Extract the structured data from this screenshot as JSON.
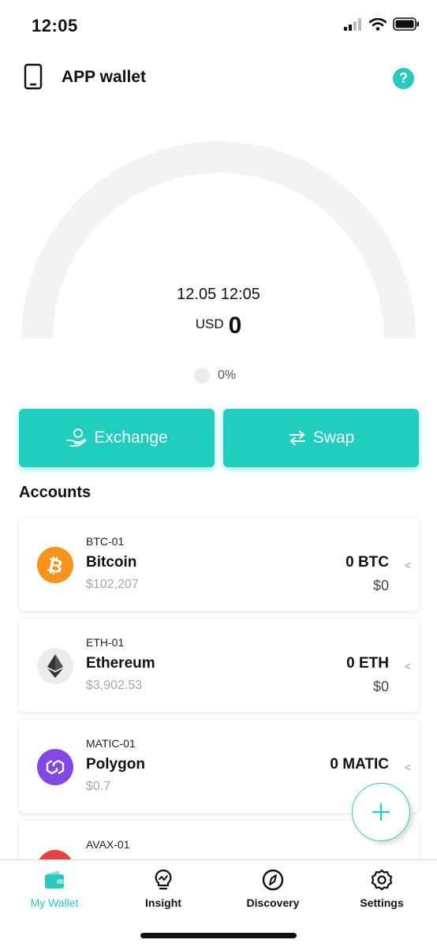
{
  "status_bar": {
    "time": "12:05"
  },
  "header": {
    "title": "APP wallet",
    "help_icon": "?"
  },
  "gauge": {
    "datetime": "12.05 12:05",
    "currency": "USD",
    "value": "0",
    "percent": "0%",
    "percent_fill": 0
  },
  "actions": {
    "exchange_label": "Exchange",
    "swap_label": "Swap"
  },
  "accounts": {
    "title": "Accounts",
    "items": [
      {
        "id": "BTC-01",
        "name": "Bitcoin",
        "price": "$102,207",
        "balance": "0 BTC",
        "fiat": "$0",
        "icon": "bitcoin-icon",
        "color": "#f7931a"
      },
      {
        "id": "ETH-01",
        "name": "Ethereum",
        "price": "$3,902.53",
        "balance": "0 ETH",
        "fiat": "$0",
        "icon": "ethereum-icon",
        "color": "#ececec"
      },
      {
        "id": "MATIC-01",
        "name": "Polygon",
        "price": "$0.7",
        "balance": "0 MATIC",
        "fiat": "",
        "icon": "polygon-icon",
        "color": "#8247e5"
      },
      {
        "id": "AVAX-01",
        "name": "",
        "price": "",
        "balance": "",
        "fiat": "",
        "icon": "avalanche-icon",
        "color": "#e84142"
      }
    ]
  },
  "nav": {
    "items": [
      {
        "label": "My Wallet",
        "icon": "wallet-icon",
        "active": true
      },
      {
        "label": "Insight",
        "icon": "lightbulb-icon",
        "active": false
      },
      {
        "label": "Discovery",
        "icon": "compass-icon",
        "active": false
      },
      {
        "label": "Settings",
        "icon": "gear-icon",
        "active": false
      }
    ]
  },
  "colors": {
    "accent": "#1fcebe",
    "help": "#2bc9bd",
    "gauge_track": "#f3f3f3"
  }
}
